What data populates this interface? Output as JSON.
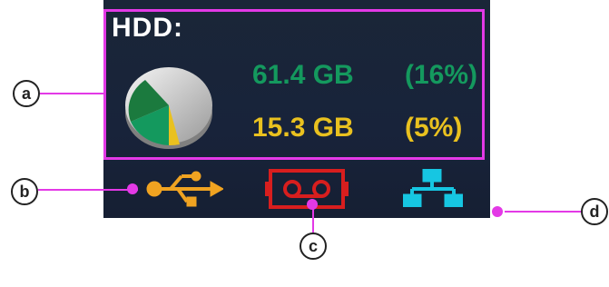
{
  "hdd": {
    "label": "HDD:",
    "used_size": "61.4 GB",
    "used_percent": "(16%)",
    "free_size": "15.3 GB",
    "free_percent": "(5%)",
    "colors": {
      "used": "#14995e",
      "free": "#e9c11f"
    }
  },
  "icons": {
    "usb": "usb-icon",
    "tape": "tape-icon",
    "network": "network-icon"
  },
  "callouts": [
    "a",
    "b",
    "c",
    "d"
  ],
  "colors": {
    "highlight": "#e339e6",
    "panel": "#1a2638"
  }
}
